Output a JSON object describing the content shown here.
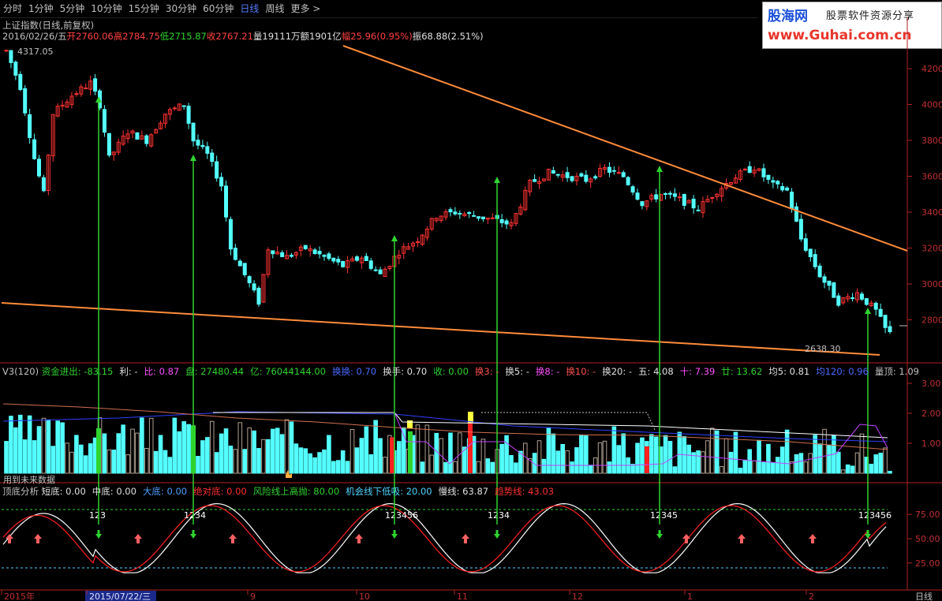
{
  "toolbar": {
    "items": [
      "分时",
      "1分钟",
      "5分钟",
      "10分钟",
      "15分钟",
      "30分钟",
      "60分钟",
      "日线",
      "周线",
      "更多 >"
    ],
    "active": "日线"
  },
  "logo": {
    "brand": "股海网",
    "slogan": "股票软件资源分享",
    "url": "www.Guhai.com.cn"
  },
  "header": {
    "title": "上证指数(日线,前复权)",
    "date": "2016/02/26/五",
    "open_label": "开",
    "open": "2760.06",
    "high_label": "高",
    "high": "2784.75",
    "low_label": "低",
    "low": "2715.87",
    "close_label": "收",
    "close": "2767.21",
    "vol_label": "量",
    "vol": "19111万",
    "amount_label": "额",
    "amount": "1901亿",
    "change_label": "幅",
    "change": "25.96(0.95%)",
    "amp_label": "振",
    "amp": "68.88(2.51%)"
  },
  "price_pane": {
    "high_mark": "4317.05",
    "low_mark": "2638.30",
    "axis_ticks": [
      "4200",
      "4000",
      "3800",
      "3600",
      "3400",
      "3200",
      "3000",
      "2800"
    ]
  },
  "vol_pane": {
    "label": "V3(120)",
    "fields": [
      {
        "k": "资金进出:",
        "v": "-83.15",
        "color": "#2fd42f"
      },
      {
        "k": "利:",
        "v": "-",
        "color": "#e0e0e0"
      },
      {
        "k": "比:",
        "v": "0.87",
        "color": "#ff50ff"
      },
      {
        "k": "盘:",
        "v": "27480.44",
        "color": "#2fd42f"
      },
      {
        "k": "亿:",
        "v": "76044144.00",
        "color": "#2fd42f"
      },
      {
        "k": "换换:",
        "v": "0.70",
        "color": "#4a6aff"
      },
      {
        "k": "换手:",
        "v": "0.70",
        "color": "#e0e0e0"
      },
      {
        "k": "收:",
        "v": "0.00",
        "color": "#2fd42f"
      },
      {
        "k": "换3:",
        "v": "-",
        "color": "#ff5050"
      },
      {
        "k": "换5:",
        "v": "-",
        "color": "#e0e0e0"
      },
      {
        "k": "换8:",
        "v": "-",
        "color": "#ff50ff"
      },
      {
        "k": "换10:",
        "v": "-",
        "color": "#ff5050"
      },
      {
        "k": "换20:",
        "v": "-",
        "color": "#e0e0e0"
      },
      {
        "k": "五:",
        "v": "4.08",
        "color": "#e0e0e0"
      },
      {
        "k": "十:",
        "v": "7.39",
        "color": "#ff50ff"
      },
      {
        "k": "廿:",
        "v": "13.62",
        "color": "#2fd42f"
      },
      {
        "k": "均5:",
        "v": "0.81",
        "color": "#e0e0e0"
      },
      {
        "k": "均120:",
        "v": "0.96",
        "color": "#4a6aff"
      },
      {
        "k": "量顶:",
        "v": "1.09",
        "color": "#c0c0c0"
      }
    ],
    "axis_ticks": [
      "3.00",
      "2.00",
      "1.00"
    ],
    "note": "用到未来数据"
  },
  "osc_pane": {
    "label": "顶底分析",
    "fields": [
      {
        "k": "短底:",
        "v": "0.00",
        "color": "#e0e0e0"
      },
      {
        "k": "中底:",
        "v": "0.00",
        "color": "#e0e0e0"
      },
      {
        "k": "大底:",
        "v": "0.00",
        "color": "#4aa0ff"
      },
      {
        "k": "绝对底:",
        "v": "0.00",
        "color": "#ff3030"
      },
      {
        "k": "风险线上高抛:",
        "v": "80.00",
        "color": "#2fd42f"
      },
      {
        "k": "机会线下低吸:",
        "v": "20.00",
        "color": "#4ad4ff"
      },
      {
        "k": "慢线:",
        "v": "63.87",
        "color": "#e0e0e0"
      },
      {
        "k": "趋势线:",
        "v": "43.03",
        "color": "#ff3030"
      }
    ],
    "axis_ticks": [
      "75.00",
      "50.00",
      "25.00"
    ],
    "markers": [
      "123",
      "1234",
      "123456",
      "1234",
      "12345",
      "123456"
    ]
  },
  "date_axis": {
    "labels": [
      "2015年",
      "2015/07/22/三",
      "9",
      "10",
      "11",
      "12",
      "1",
      "2"
    ],
    "period": "日线"
  },
  "colors": {
    "up": "#ff3232",
    "down": "#54ffff",
    "trend": "#ff8c3a",
    "arrow": "#2fd42f"
  }
}
